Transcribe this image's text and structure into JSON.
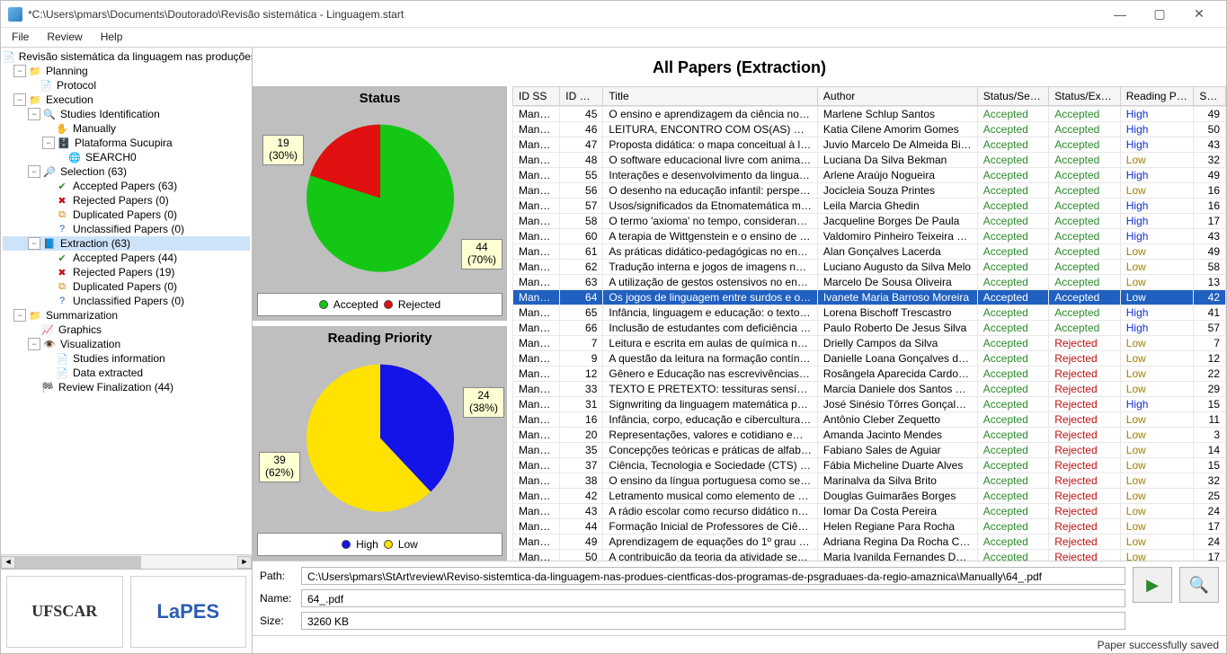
{
  "window": {
    "title": "*C:\\Users\\pmars\\Documents\\Doutorado\\Revisão sistemática - Linguagem.start"
  },
  "menu": {
    "file": "File",
    "review": "Review",
    "help": "Help"
  },
  "tree": {
    "root": "Revisão sistemática da linguagem nas produções cie…",
    "planning": "Planning",
    "protocol": "Protocol",
    "execution": "Execution",
    "studies_identification": "Studies Identification",
    "manually": "Manually",
    "plataforma": "Plataforma Sucupira",
    "search0": "SEARCH0",
    "selection": "Selection (63)",
    "s_accepted": "Accepted Papers (63)",
    "s_rejected": "Rejected Papers (0)",
    "s_duplicated": "Duplicated Papers (0)",
    "s_unclassified": "Unclassified Papers (0)",
    "extraction": "Extraction (63)",
    "e_accepted": "Accepted Papers (44)",
    "e_rejected": "Rejected Papers (19)",
    "e_duplicated": "Duplicated Papers (0)",
    "e_unclassified": "Unclassified Papers (0)",
    "summarization": "Summarization",
    "graphics": "Graphics",
    "visualization": "Visualization",
    "studies_info": "Studies information",
    "data_extracted": "Data extracted",
    "review_finalization": "Review Finalization (44)"
  },
  "page": {
    "title": "All Papers (Extraction)"
  },
  "chart_data": [
    {
      "type": "pie",
      "title": "Status",
      "series": [
        {
          "name": "Accepted",
          "value": 44,
          "pct": 70,
          "color": "#14c714"
        },
        {
          "name": "Rejected",
          "value": 19,
          "pct": 30,
          "color": "#e01010"
        }
      ],
      "callout_a": "44\n(70%)",
      "callout_b": "19\n(30%)",
      "legend_a": "Accepted",
      "legend_b": "Rejected"
    },
    {
      "type": "pie",
      "title": "Reading Priority",
      "series": [
        {
          "name": "High",
          "value": 24,
          "pct": 38,
          "color": "#1414e8"
        },
        {
          "name": "Low",
          "value": 39,
          "pct": 62,
          "color": "#ffe200"
        }
      ],
      "callout_a": "24\n(38%)",
      "callout_b": "39\n(62%)",
      "legend_a": "High",
      "legend_b": "Low"
    }
  ],
  "columns": {
    "idss": "ID SS",
    "idp": "ID P…",
    "title": "Title",
    "author": "Author",
    "ssel": "Status/Sele…",
    "sextr": "Status/Extr…",
    "rp": "Reading Pri…",
    "sc": "Sc…"
  },
  "rows": [
    {
      "idss": "Manually",
      "idp": 45,
      "title": "O ensino e aprendizagem da ciência no ensi…",
      "author": "Marlene Schlup Santos",
      "ssel": "Accepted",
      "sextr": "Accepted",
      "rp": "High",
      "sc": 49
    },
    {
      "idss": "Manually",
      "idp": 46,
      "title": "LEITURA, ENCONTRO COM OS(AS) OUTRO…",
      "author": "Katia Cilene Amorim Gomes",
      "ssel": "Accepted",
      "sextr": "Accepted",
      "rp": "High",
      "sc": 50
    },
    {
      "idss": "Manually",
      "idp": 47,
      "title": "Proposta didática: o mapa conceitual à luz d…",
      "author": "Juvio Marcelo De Almeida Bittenc…",
      "ssel": "Accepted",
      "sextr": "Accepted",
      "rp": "High",
      "sc": 43
    },
    {
      "idss": "Manually",
      "idp": 48,
      "title": "O software educacional livre com animação i…",
      "author": "Luciana Da Silva Bekman",
      "ssel": "Accepted",
      "sextr": "Accepted",
      "rp": "Low",
      "sc": 32
    },
    {
      "idss": "Manually",
      "idp": 55,
      "title": "Interações e desenvolvimento da linguagem…",
      "author": "Arlene Araújo Nogueira",
      "ssel": "Accepted",
      "sextr": "Accepted",
      "rp": "High",
      "sc": 49
    },
    {
      "idss": "Manually",
      "idp": 56,
      "title": "O desenho na educação infantil: perspectiv…",
      "author": "Jocicleia Souza Printes",
      "ssel": "Accepted",
      "sextr": "Accepted",
      "rp": "Low",
      "sc": 16
    },
    {
      "idss": "Manually",
      "idp": 57,
      "title": "Usos/significados da Etnomatemática mobiliz…",
      "author": "Leila Marcia Ghedin",
      "ssel": "Accepted",
      "sextr": "Accepted",
      "rp": "High",
      "sc": 16
    },
    {
      "idss": "Manually",
      "idp": 58,
      "title": "O termo 'axioma' no tempo, considerando a …",
      "author": "Jacqueline Borges De Paula",
      "ssel": "Accepted",
      "sextr": "Accepted",
      "rp": "High",
      "sc": 17
    },
    {
      "idss": "Manually",
      "idp": 60,
      "title": "A terapia de Wittgenstein e o ensino de álge…",
      "author": "Valdomiro Pinheiro Teixeira Junior",
      "ssel": "Accepted",
      "sextr": "Accepted",
      "rp": "High",
      "sc": 43
    },
    {
      "idss": "Manually",
      "idp": 61,
      "title": "As práticas didático-pedagógicas no ensino …",
      "author": "Alan Gonçalves Lacerda",
      "ssel": "Accepted",
      "sextr": "Accepted",
      "rp": "Low",
      "sc": 49
    },
    {
      "idss": "Manually",
      "idp": 62,
      "title": "Tradução interna e jogos de imagens na mat…",
      "author": "Luciano Augusto da Silva Melo",
      "ssel": "Accepted",
      "sextr": "Accepted",
      "rp": "Low",
      "sc": 58
    },
    {
      "idss": "Manually",
      "idp": 63,
      "title": "A utilização de gestos ostensivos no ensino …",
      "author": "Marcelo De Sousa Oliveira",
      "ssel": "Accepted",
      "sextr": "Accepted",
      "rp": "Low",
      "sc": 13
    },
    {
      "idss": "Manually",
      "idp": 64,
      "title": "Os jogos de linguagem entre surdos e ouvin…",
      "author": "Ivanete Maria Barroso Moreira",
      "ssel": "Accepted",
      "sextr": "Accepted",
      "rp": "Low",
      "sc": 42,
      "selected": true
    },
    {
      "idss": "Manually",
      "idp": 65,
      "title": "Infância, linguagem e educação: o texto esc…",
      "author": "Lorena Bischoff Trescastro",
      "ssel": "Accepted",
      "sextr": "Accepted",
      "rp": "High",
      "sc": 41
    },
    {
      "idss": "Manually",
      "idp": 66,
      "title": "Inclusão de estudantes com deficiência visu…",
      "author": "Paulo Roberto De Jesus Silva",
      "ssel": "Accepted",
      "sextr": "Accepted",
      "rp": "High",
      "sc": 57
    },
    {
      "idss": "Manually",
      "idp": 7,
      "title": "Leitura e escrita em aulas de química no ensi…",
      "author": "Drielly Campos da Silva",
      "ssel": "Accepted",
      "sextr": "Rejected",
      "rp": "Low",
      "sc": 7
    },
    {
      "idss": "Manually",
      "idp": 9,
      "title": "A questão da leitura na formação contínua d…",
      "author": "Danielle Loana Gonçalves de Souza",
      "ssel": "Accepted",
      "sextr": "Rejected",
      "rp": "Low",
      "sc": 12
    },
    {
      "idss": "Manually",
      "idp": 12,
      "title": "Gênero e Educação nas escrevivências de c…",
      "author": "Rosângela Aparecida Cardoso d…",
      "ssel": "Accepted",
      "sextr": "Rejected",
      "rp": "Low",
      "sc": 22
    },
    {
      "idss": "Manually",
      "idp": 33,
      "title": "TEXTO E PRETEXTO: tessituras sensíveis de …",
      "author": "Marcia Daniele dos Santos Lobato",
      "ssel": "Accepted",
      "sextr": "Rejected",
      "rp": "Low",
      "sc": 29
    },
    {
      "idss": "Manually",
      "idp": 31,
      "title": "Signwriting da linguagem matemática para o …",
      "author": "José Sinésio Tôrres Gonçalves Filho",
      "ssel": "Accepted",
      "sextr": "Rejected",
      "rp": "High",
      "sc": 15
    },
    {
      "idss": "Manually",
      "idp": 16,
      "title": "Infância, corpo, educação e cibercultura: cri…",
      "author": "Antônio Cleber Zequetto",
      "ssel": "Accepted",
      "sextr": "Rejected",
      "rp": "Low",
      "sc": 11
    },
    {
      "idss": "Manually",
      "idp": 20,
      "title": "Representações, valores e cotidiano em nar…",
      "author": "Amanda Jacinto Mendes",
      "ssel": "Accepted",
      "sextr": "Rejected",
      "rp": "Low",
      "sc": 3
    },
    {
      "idss": "Manually",
      "idp": 35,
      "title": "Concepções teóricas e práticas de alfabetiz…",
      "author": "Fabiano Sales de Aguiar",
      "ssel": "Accepted",
      "sextr": "Rejected",
      "rp": "Low",
      "sc": 14
    },
    {
      "idss": "Manually",
      "idp": 37,
      "title": "Ciência, Tecnologia e Sociedade (CTS) nos C…",
      "author": "Fábia Micheline Duarte Alves",
      "ssel": "Accepted",
      "sextr": "Rejected",
      "rp": "Low",
      "sc": 15
    },
    {
      "idss": "Manually",
      "idp": 38,
      "title": "O ensino da língua portuguesa como segund…",
      "author": "Marinalva da Silva Brito",
      "ssel": "Accepted",
      "sextr": "Rejected",
      "rp": "Low",
      "sc": 32
    },
    {
      "idss": "Manually",
      "idp": 42,
      "title": "Letramento musical como elemento de auxíli…",
      "author": "Douglas Guimarães Borges",
      "ssel": "Accepted",
      "sextr": "Rejected",
      "rp": "Low",
      "sc": 25
    },
    {
      "idss": "Manually",
      "idp": 43,
      "title": "A rádio escolar como recurso didático no ens…",
      "author": "Iomar Da Costa Pereira",
      "ssel": "Accepted",
      "sextr": "Rejected",
      "rp": "Low",
      "sc": 24
    },
    {
      "idss": "Manually",
      "idp": 44,
      "title": "Formação Inicial de Professores de Ciências:…",
      "author": "Helen Regiane Para Rocha",
      "ssel": "Accepted",
      "sextr": "Rejected",
      "rp": "Low",
      "sc": 17
    },
    {
      "idss": "Manually",
      "idp": 49,
      "title": "Aprendizagem de equações do 1º grau a pa…",
      "author": "Adriana Regina Da Rocha Chirone",
      "ssel": "Accepted",
      "sextr": "Rejected",
      "rp": "Low",
      "sc": 24
    },
    {
      "idss": "Manually",
      "idp": 50,
      "title": "A contribuição da teoria da atividade segun…",
      "author": "Maria Ivanilda Fernandes De Lac…",
      "ssel": "Accepted",
      "sextr": "Rejected",
      "rp": "Low",
      "sc": 17
    }
  ],
  "bottom": {
    "path_label": "Path:",
    "path": "C:\\Users\\pmars\\StArt\\review\\Reviso-sistemtica-da-linguagem-nas-produes-cientficas-dos-programas-de-psgraduaes-da-regio-amaznica\\Manually\\64_.pdf",
    "name_label": "Name:",
    "name": "64_.pdf",
    "size_label": "Size:",
    "size": "3260 KB"
  },
  "status": {
    "message": "Paper successfully saved"
  },
  "logos": {
    "ufscar": "UFSCAR",
    "lapes": "LaPES"
  }
}
